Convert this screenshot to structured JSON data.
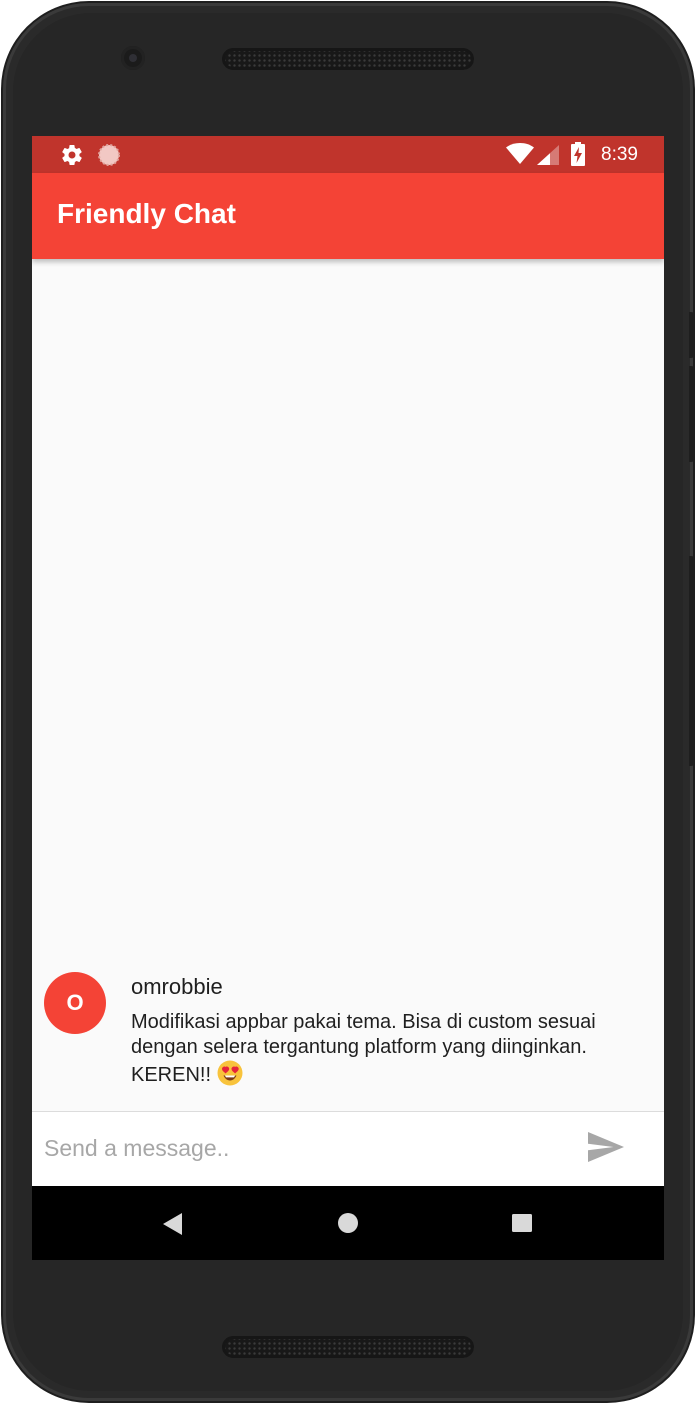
{
  "status_bar": {
    "time": "8:39",
    "left_icons": [
      "gear-icon",
      "sync-indicator-icon"
    ],
    "right_icons": [
      "wifi-icon",
      "cell-signal-icon",
      "battery-charging-icon"
    ]
  },
  "app_bar": {
    "title": "Friendly Chat",
    "color": "#f44336"
  },
  "messages": [
    {
      "avatar_initial": "O",
      "sender": "omrobbie",
      "text": "Modifikasi appbar pakai tema. Bisa di custom sesuai dengan selera tergantung platform yang diinginkan. KEREN!!",
      "emoji": "smiling-face-with-heart-eyes-icon"
    }
  ],
  "composer": {
    "placeholder": "Send a message..",
    "value": "",
    "send_icon": "send-icon"
  },
  "nav_bar": [
    "back-icon",
    "home-icon",
    "recents-icon"
  ],
  "colors": {
    "accent": "#f44336",
    "status_bar": "#c0342c",
    "background": "#fafafa"
  }
}
